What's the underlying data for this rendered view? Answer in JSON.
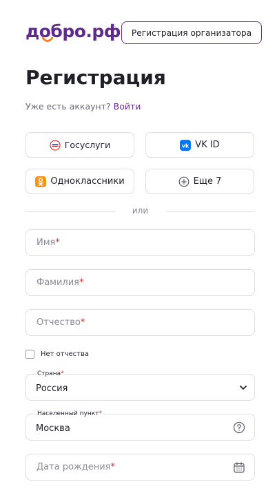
{
  "header": {
    "logo_text": "добро.рф",
    "organizer_button": "Регистрация организатора"
  },
  "page": {
    "title": "Регистрация",
    "have_account_text": "Уже есть аккаунт?",
    "login_link": "Войти"
  },
  "social": {
    "gosuslugi": "Госуслуги",
    "vkid": "VK ID",
    "ok": "Одноклассники",
    "more": "Еще 7"
  },
  "divider": {
    "text": "или"
  },
  "form": {
    "name_placeholder": "Имя",
    "surname_placeholder": "Фамилия",
    "patronymic_placeholder": "Отчество",
    "required_mark": "*",
    "no_patronymic_label": "Нет отчества",
    "country_label": "Страна",
    "country_value": "Россия",
    "city_label": "Населенный пункт",
    "city_value": "Москва",
    "dob_placeholder": "Дата рождения"
  },
  "colors": {
    "brand": "#6a2c91",
    "required": "#d32f2f",
    "vk": "#0077ff",
    "ok": "#f7931e",
    "smile": "#f58220"
  }
}
